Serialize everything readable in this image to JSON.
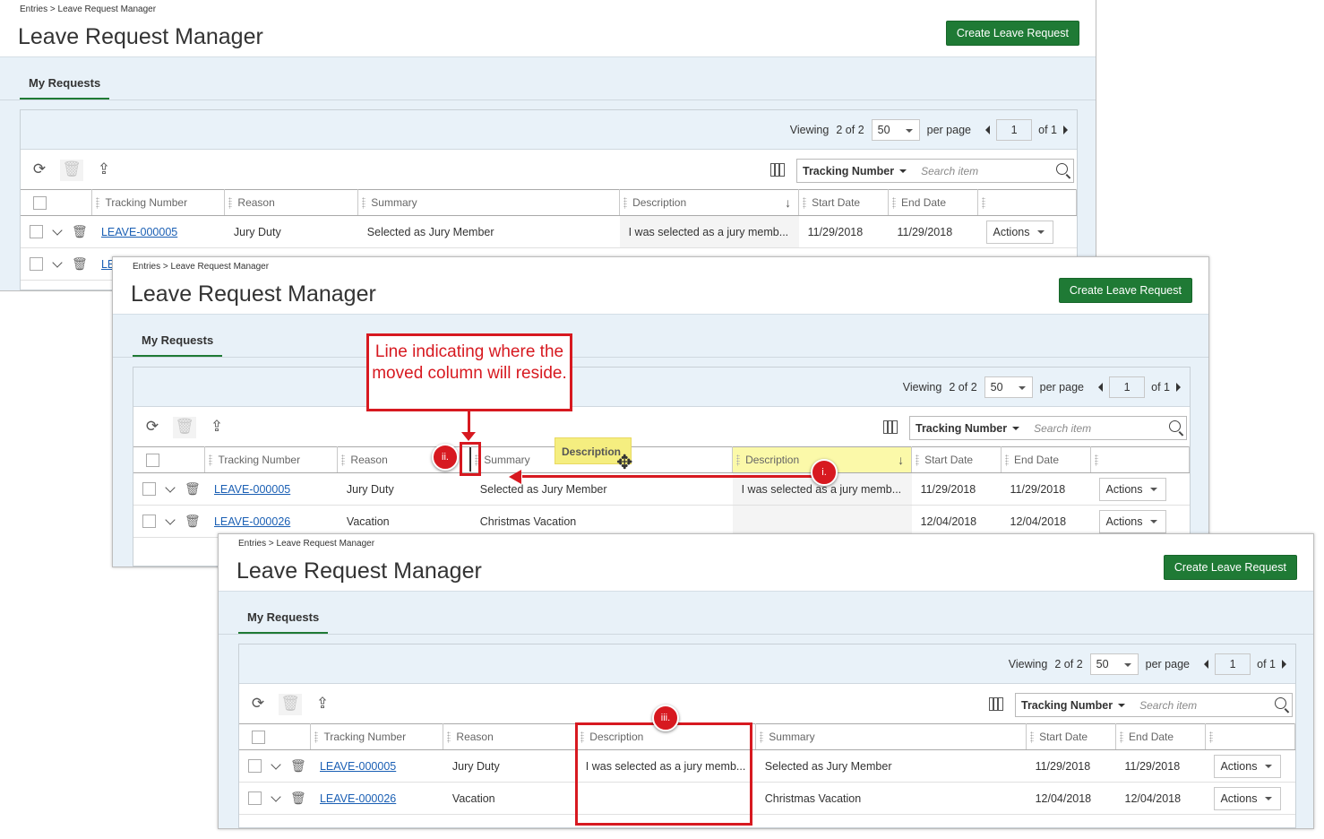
{
  "breadcrumb": "Entries > Leave Request Manager",
  "page_title": "Leave Request Manager",
  "create_button": "Create Leave Request",
  "tab_label": "My Requests",
  "viewing": {
    "label": "Viewing",
    "count": "2",
    "of": "of",
    "total": "2",
    "per_page_value": "50",
    "per_page_label": "per page",
    "page": "1",
    "of_pages": "of 1"
  },
  "search": {
    "field": "Tracking Number",
    "placeholder": "Search item"
  },
  "columns": {
    "tracking": "Tracking Number",
    "reason": "Reason",
    "summary": "Summary",
    "description": "Description",
    "start": "Start Date",
    "end": "End Date"
  },
  "rows": [
    {
      "tracking": "LEAVE-000005",
      "reason": "Jury Duty",
      "summary": "Selected as Jury Member",
      "description": "I was selected as a jury memb...",
      "start": "11/29/2018",
      "end": "11/29/2018",
      "action": "Actions"
    },
    {
      "tracking": "LEAVE-000026",
      "reason": "Vacation",
      "summary": "Christmas Vacation",
      "description": "",
      "start": "12/04/2018",
      "end": "12/04/2018",
      "action": "Actions"
    }
  ],
  "partial_link_text": "LE",
  "drag_chip": "Description",
  "annotations": {
    "callout": "Line indicating where the moved column will reside.",
    "badge_i": "i.",
    "badge_ii": "ii.",
    "badge_iii": "iii."
  },
  "colors": {
    "brand_green": "#1f7a35",
    "annotation_red": "#d71920",
    "highlight_yellow": "#fbf9a9",
    "band_blue": "#e8f1f8"
  }
}
